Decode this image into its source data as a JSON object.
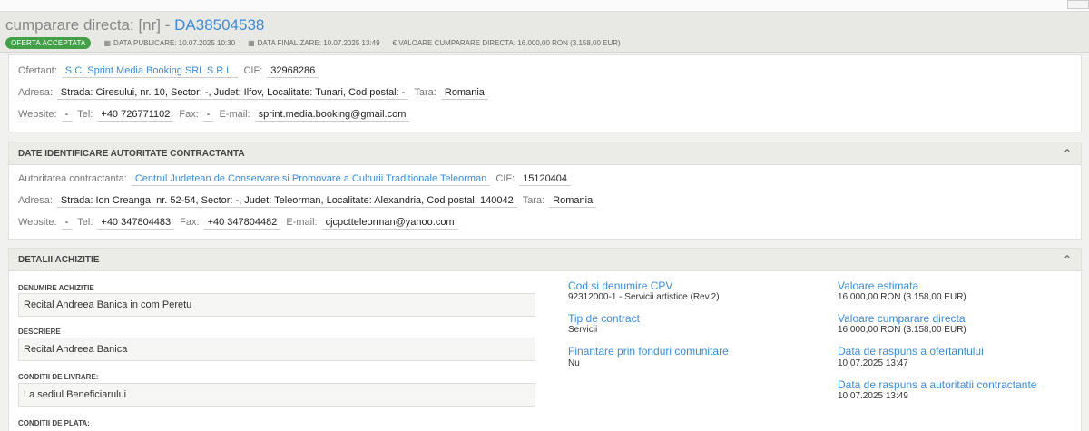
{
  "header": {
    "title_prefix": "cumparare directa: [nr] - ",
    "title_code": "DA38504538",
    "status_badge": "OFERTA ACCEPTATA",
    "data_publicare": "DATA PUBLICARE: 10.07.2025 10:30",
    "data_finalizare": "DATA FINALIZARE: 10.07.2025 13:49",
    "valoare": "€ VALOARE CUMPARARE DIRECTA: 16.000,00  RON (3.158,00  EUR)",
    "colors": {
      "accent": "#3d8bd6",
      "badge": "#43a047"
    }
  },
  "ofertant": {
    "ofertant_label": "Ofertant:",
    "ofertant_value": "S.C. Sprint Media Booking SRL S.R.L.",
    "cif_label": "CIF:",
    "cif_value": "32968286",
    "adresa_label": "Adresa:",
    "adresa_value": "Strada: Ciresului, nr. 10, Sector: -, Judet: Ilfov, Localitate: Tunari, Cod postal: -",
    "tara_label": "Tara:",
    "tara_value": "Romania",
    "website_label": "Website:",
    "website_value": "-",
    "tel_label": "Tel:",
    "tel_value": "+40 726771102",
    "fax_label": "Fax:",
    "fax_value": "-",
    "email_label": "E-mail:",
    "email_value": "sprint.media.booking@gmail.com"
  },
  "autoritate": {
    "section_title": "DATE IDENTIFICARE AUTORITATE CONTRACTANTA",
    "autoritate_label": "Autoritatea contractanta:",
    "autoritate_value": "Centrul Judetean de Conservare si Promovare a Culturii Traditionale Teleorman",
    "cif_label": "CIF:",
    "cif_value": "15120404",
    "adresa_label": "Adresa:",
    "adresa_value": "Strada: Ion Creanga, nr. 52-54, Sector: -, Judet: Teleorman, Localitate: Alexandria, Cod postal: 140042",
    "tara_label": "Tara:",
    "tara_value": "Romania",
    "website_label": "Website:",
    "website_value": "-",
    "tel_label": "Tel:",
    "tel_value": "+40 347804483",
    "fax_label": "Fax:",
    "fax_value": "+40 347804482",
    "email_label": "E-mail:",
    "email_value": "cjcpctteleorman@yahoo.com"
  },
  "achizitie": {
    "section_title": "DETALII ACHIZITIE",
    "denumire_label": "DENUMIRE ACHIZITIE",
    "denumire_value": "Recital Andreea Banica in com Peretu",
    "descriere_label": "DESCRIERE",
    "descriere_value": "Recital Andreea Banica",
    "livrare_label": "CONDITII DE LIVRARE:",
    "livrare_value": "La sediul Beneficiarului",
    "plata_label": "CONDITII DE PLATA:",
    "cpv_title": "Cod si denumire CPV",
    "cpv_value": "92312000-1 - Servicii artistice (Rev.2)",
    "tip_title": "Tip de contract",
    "tip_value": "Servicii",
    "fonduri_title": "Finantare prin fonduri comunitare",
    "fonduri_value": "Nu",
    "estimata_title": "Valoare estimata",
    "estimata_value": "16.000,00  RON (3.158,00  EUR)",
    "cumparare_title": "Valoare cumparare directa",
    "cumparare_value": "16.000,00  RON (3.158,00  EUR)",
    "raspuns_ofertant_title": "Data de raspuns a ofertantului",
    "raspuns_ofertant_value": "10.07.2025 13:47",
    "raspuns_autoritate_title": "Data de raspuns a autoritatii contractante",
    "raspuns_autoritate_value": "10.07.2025 13:49"
  }
}
